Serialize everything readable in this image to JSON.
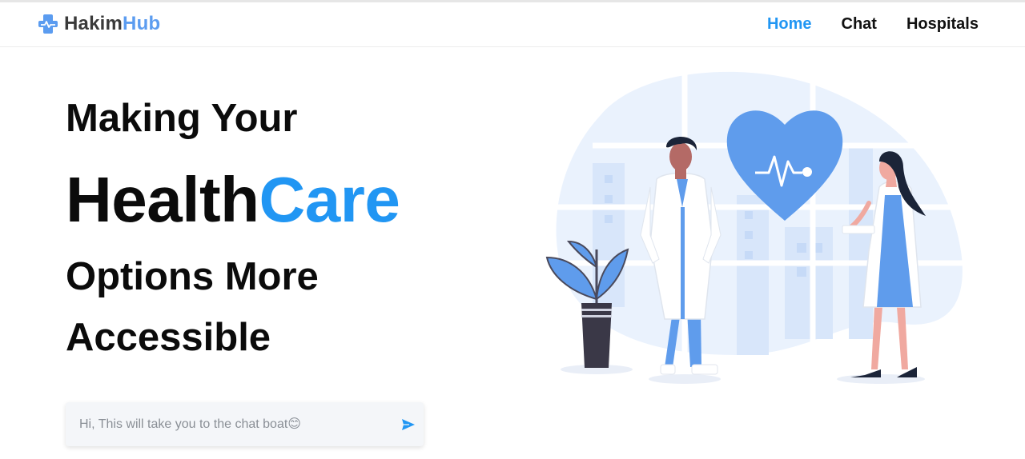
{
  "brand": {
    "name_part1": "Hakim",
    "name_part2": "Hub"
  },
  "nav": {
    "items": [
      {
        "label": "Home",
        "active": true
      },
      {
        "label": "Chat"
      },
      {
        "label": "Hospitals"
      }
    ]
  },
  "hero": {
    "line1": "Making Your",
    "line2_a": "Health",
    "line2_b": "Care",
    "line3": "Options More",
    "line4": "Accessible"
  },
  "chat": {
    "placeholder": "Hi, This will take you to the chat boat😊"
  },
  "colors": {
    "accent": "#2196f3",
    "brand_secondary": "#5b9cf0",
    "illustration_blue": "#5f9cec"
  },
  "icons": [
    "medical-cross-icon",
    "send-icon"
  ]
}
